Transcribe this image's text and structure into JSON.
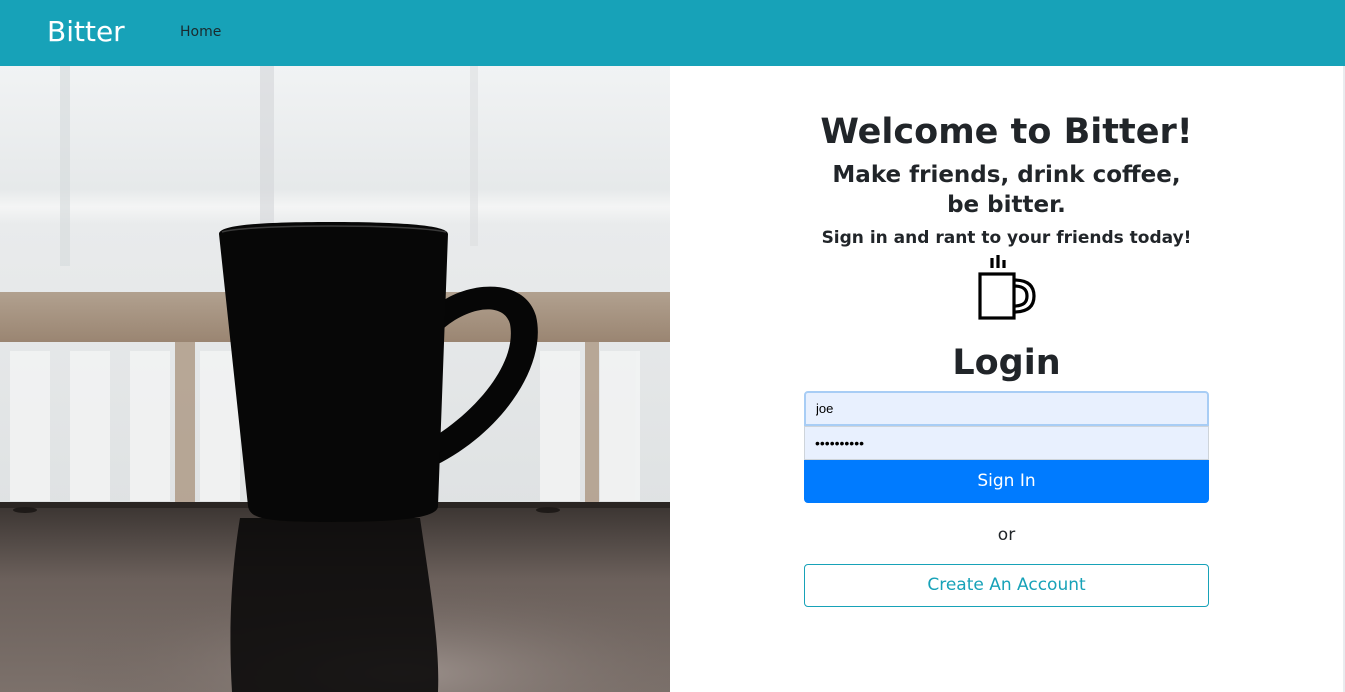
{
  "navbar": {
    "brand": "Bitter",
    "home_link": "Home",
    "color": "#17a2b8"
  },
  "hero": {
    "image_icon": "coffee-mug-photo"
  },
  "login": {
    "welcome": "Welcome to Bitter!",
    "tagline": "Make friends, drink coffee, be bitter.",
    "subtagline": "Sign in and rant to your friends today!",
    "icon": "coffee-cup-icon",
    "title": "Login",
    "username_value": "joe",
    "password_value": "••••••••••",
    "signin_label": "Sign In",
    "or_label": "or",
    "create_label": "Create An Account",
    "primary_color": "#007bff",
    "secondary_color": "#17a2b8"
  }
}
